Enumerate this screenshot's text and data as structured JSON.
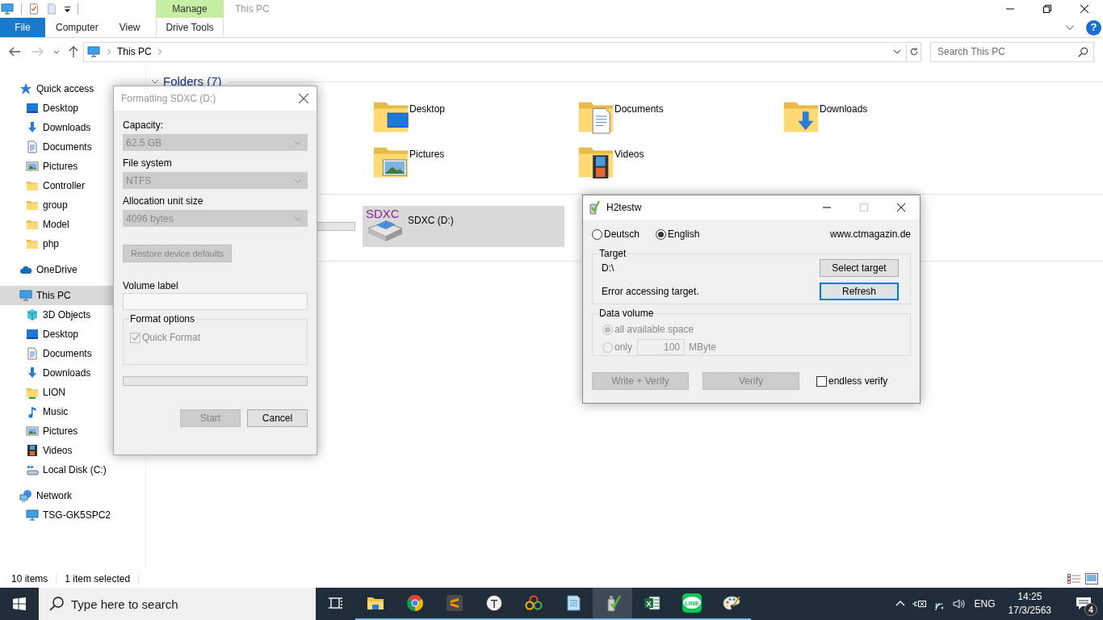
{
  "explorer": {
    "window": {
      "title": "This PC",
      "active": false
    },
    "window_buttons": [
      {
        "kind": "minimize",
        "disabled": false
      },
      {
        "kind": "restore",
        "disabled": false
      },
      {
        "kind": "close",
        "disabled": false
      }
    ],
    "ribbon": {
      "context_header": "Manage",
      "tabs": [
        {
          "label": "File",
          "kind": "file",
          "selected": false
        },
        {
          "label": "Computer",
          "kind": "tab",
          "selected": false
        },
        {
          "label": "View",
          "kind": "tab",
          "selected": false
        },
        {
          "label": "Drive Tools",
          "kind": "contextual",
          "selected": false
        }
      ],
      "help": "?"
    },
    "navigation": [
      {
        "kind": "back",
        "disabled": false
      },
      {
        "kind": "forward",
        "disabled": true
      },
      {
        "kind": "recent",
        "disabled": false
      },
      {
        "kind": "up",
        "disabled": false
      }
    ],
    "address": {
      "path": [
        "This PC"
      ]
    },
    "search": {
      "placeholder": "Search This PC"
    },
    "sidebar": [
      {
        "label": "Quick access",
        "kind": "star",
        "selected": false,
        "children": [
          {
            "label": "Desktop",
            "kind": "desktop",
            "selected": false
          },
          {
            "label": "Downloads",
            "kind": "download",
            "selected": false
          },
          {
            "label": "Documents",
            "kind": "document",
            "selected": false
          },
          {
            "label": "Pictures",
            "kind": "picture",
            "selected": false
          },
          {
            "label": "Controller",
            "kind": "folder",
            "selected": false
          },
          {
            "label": "group",
            "kind": "folder",
            "selected": false
          },
          {
            "label": "Model",
            "kind": "folder",
            "selected": false
          },
          {
            "label": "php",
            "kind": "folder",
            "selected": false
          }
        ]
      },
      {
        "label": "OneDrive",
        "kind": "cloud",
        "selected": false
      },
      {
        "label": "This PC",
        "kind": "computer",
        "selected": true,
        "children": [
          {
            "label": "3D Objects",
            "kind": "cube",
            "selected": false
          },
          {
            "label": "Desktop",
            "kind": "desktop",
            "selected": false
          },
          {
            "label": "Documents",
            "kind": "document",
            "selected": false
          },
          {
            "label": "Downloads",
            "kind": "download",
            "selected": false
          },
          {
            "label": "LION",
            "kind": "shared-folder",
            "selected": false
          },
          {
            "label": "Music",
            "kind": "music",
            "selected": false
          },
          {
            "label": "Pictures",
            "kind": "picture",
            "selected": false
          },
          {
            "label": "Videos",
            "kind": "film",
            "selected": false
          },
          {
            "label": "Local Disk (C:)",
            "kind": "disk",
            "selected": false
          }
        ]
      },
      {
        "label": "Network",
        "kind": "network",
        "selected": false,
        "children": [
          {
            "label": "TSG-GK5SPC2",
            "kind": "computer",
            "selected": false
          }
        ]
      }
    ],
    "folders": {
      "title": "Folders (7)",
      "expanded": true,
      "rows": [
        [
          {
            "label": "Desktop",
            "kind": "desktop",
            "selected": false
          },
          {
            "label": "Documents",
            "kind": "document",
            "selected": false
          },
          {
            "label": "Downloads",
            "kind": "download",
            "selected": false
          }
        ],
        [
          {
            "label": "Pictures",
            "kind": "picture",
            "selected": false
          },
          {
            "label": "Videos",
            "kind": "film",
            "selected": false
          }
        ]
      ]
    },
    "drives": [
      {
        "label": "SDXC (D:)",
        "icon_text": "SDXC",
        "selected": true
      }
    ],
    "status": {
      "items": "10 items",
      "selection": "1 item selected"
    }
  },
  "format_dialog": {
    "title": "Formatting SDXC (D:)",
    "active": false,
    "fields": [
      {
        "label": "Capacity:",
        "value": "62.5 GB",
        "disabled": true
      },
      {
        "label": "File system",
        "value": "NTFS",
        "disabled": true
      },
      {
        "label": "Allocation unit size",
        "value": "4096 bytes",
        "disabled": true
      }
    ],
    "restore_button": {
      "label": "Restore device defaults",
      "disabled": true
    },
    "volume_label": {
      "label": "Volume label"
    },
    "options": {
      "title": "Format options",
      "items": [
        {
          "label": "Quick Format",
          "checked": true,
          "disabled": true
        }
      ]
    },
    "progress": {
      "level": 0
    },
    "buttons": [
      {
        "label": "Start",
        "disabled": true
      },
      {
        "label": "Cancel",
        "disabled": false
      }
    ]
  },
  "h2testw": {
    "title": "H2testw",
    "active": true,
    "window_buttons": [
      {
        "kind": "minimize",
        "disabled": false
      },
      {
        "kind": "maximize",
        "disabled": true
      },
      {
        "kind": "close",
        "disabled": false
      }
    ],
    "languages": [
      {
        "label": "Deutsch",
        "selected": false
      },
      {
        "label": "English",
        "selected": true
      }
    ],
    "link": "www.ctmagazin.de",
    "target": {
      "title": "Target",
      "path": "D:\\",
      "message": "Error accessing target.",
      "buttons": [
        {
          "label": "Select target",
          "focused": false
        },
        {
          "label": "Refresh",
          "focused": true
        }
      ]
    },
    "data_volume": {
      "title": "Data volume",
      "disabled": true,
      "options": [
        {
          "label": "all available space",
          "selected": true
        },
        {
          "label": "only",
          "selected": false
        }
      ],
      "amount": "100",
      "unit": "MByte"
    },
    "buttons": [
      {
        "label": "Write + Verify",
        "disabled": true
      },
      {
        "label": "Verify",
        "disabled": true
      }
    ],
    "endless": {
      "label": "endless verify",
      "checked": false
    }
  },
  "taskbar": {
    "search_placeholder": "Type here to search",
    "apps": [
      {
        "kind": "explorer",
        "running": true,
        "selected": false
      },
      {
        "kind": "browser",
        "running": true,
        "selected": false
      },
      {
        "kind": "editor",
        "running": true,
        "selected": false
      },
      {
        "kind": "letter",
        "icon_text": "T",
        "running": true,
        "selected": false
      },
      {
        "kind": "rings",
        "running": true,
        "selected": false
      },
      {
        "kind": "notebook",
        "running": true,
        "selected": false
      },
      {
        "kind": "usb",
        "running": true,
        "selected": true
      },
      {
        "kind": "spreadsheet",
        "icon_text": "X",
        "running": true,
        "selected": false
      },
      {
        "kind": "chat",
        "icon_text": "LINE",
        "running": true,
        "selected": false
      },
      {
        "kind": "palette",
        "running": true,
        "selected": false
      }
    ],
    "tray": {
      "language": "ENG",
      "time": "14:25",
      "date": "17/3/2563",
      "notifications": "4"
    }
  }
}
